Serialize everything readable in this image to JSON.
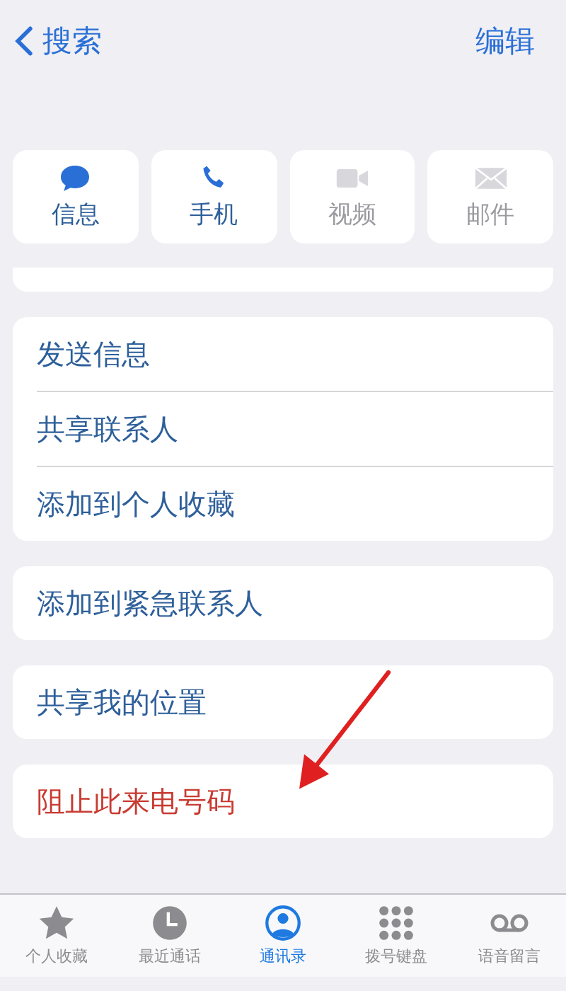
{
  "nav": {
    "back": "搜索",
    "edit": "编辑"
  },
  "actions": [
    {
      "kind": "message",
      "label": "信息",
      "disabled": false
    },
    {
      "kind": "phone",
      "label": "手机",
      "disabled": false
    },
    {
      "kind": "video",
      "label": "视频",
      "disabled": true
    },
    {
      "kind": "mail",
      "label": "邮件",
      "disabled": true
    }
  ],
  "groups": [
    {
      "items": [
        {
          "label": "发送信息"
        },
        {
          "label": "共享联系人"
        },
        {
          "label": "添加到个人收藏"
        }
      ]
    },
    {
      "items": [
        {
          "label": "添加到紧急联系人"
        }
      ]
    },
    {
      "items": [
        {
          "label": "共享我的位置"
        }
      ]
    },
    {
      "items": [
        {
          "label": "阻止此来电号码",
          "kind": "danger"
        }
      ]
    }
  ],
  "tabs": [
    {
      "kind": "star",
      "label": "个人收藏",
      "selected": false
    },
    {
      "kind": "clock",
      "label": "最近通话",
      "selected": false
    },
    {
      "kind": "person",
      "label": "通讯录",
      "selected": true
    },
    {
      "kind": "keypad",
      "label": "拨号键盘",
      "selected": false
    },
    {
      "kind": "voicemail",
      "label": "语音留言",
      "selected": false
    }
  ]
}
